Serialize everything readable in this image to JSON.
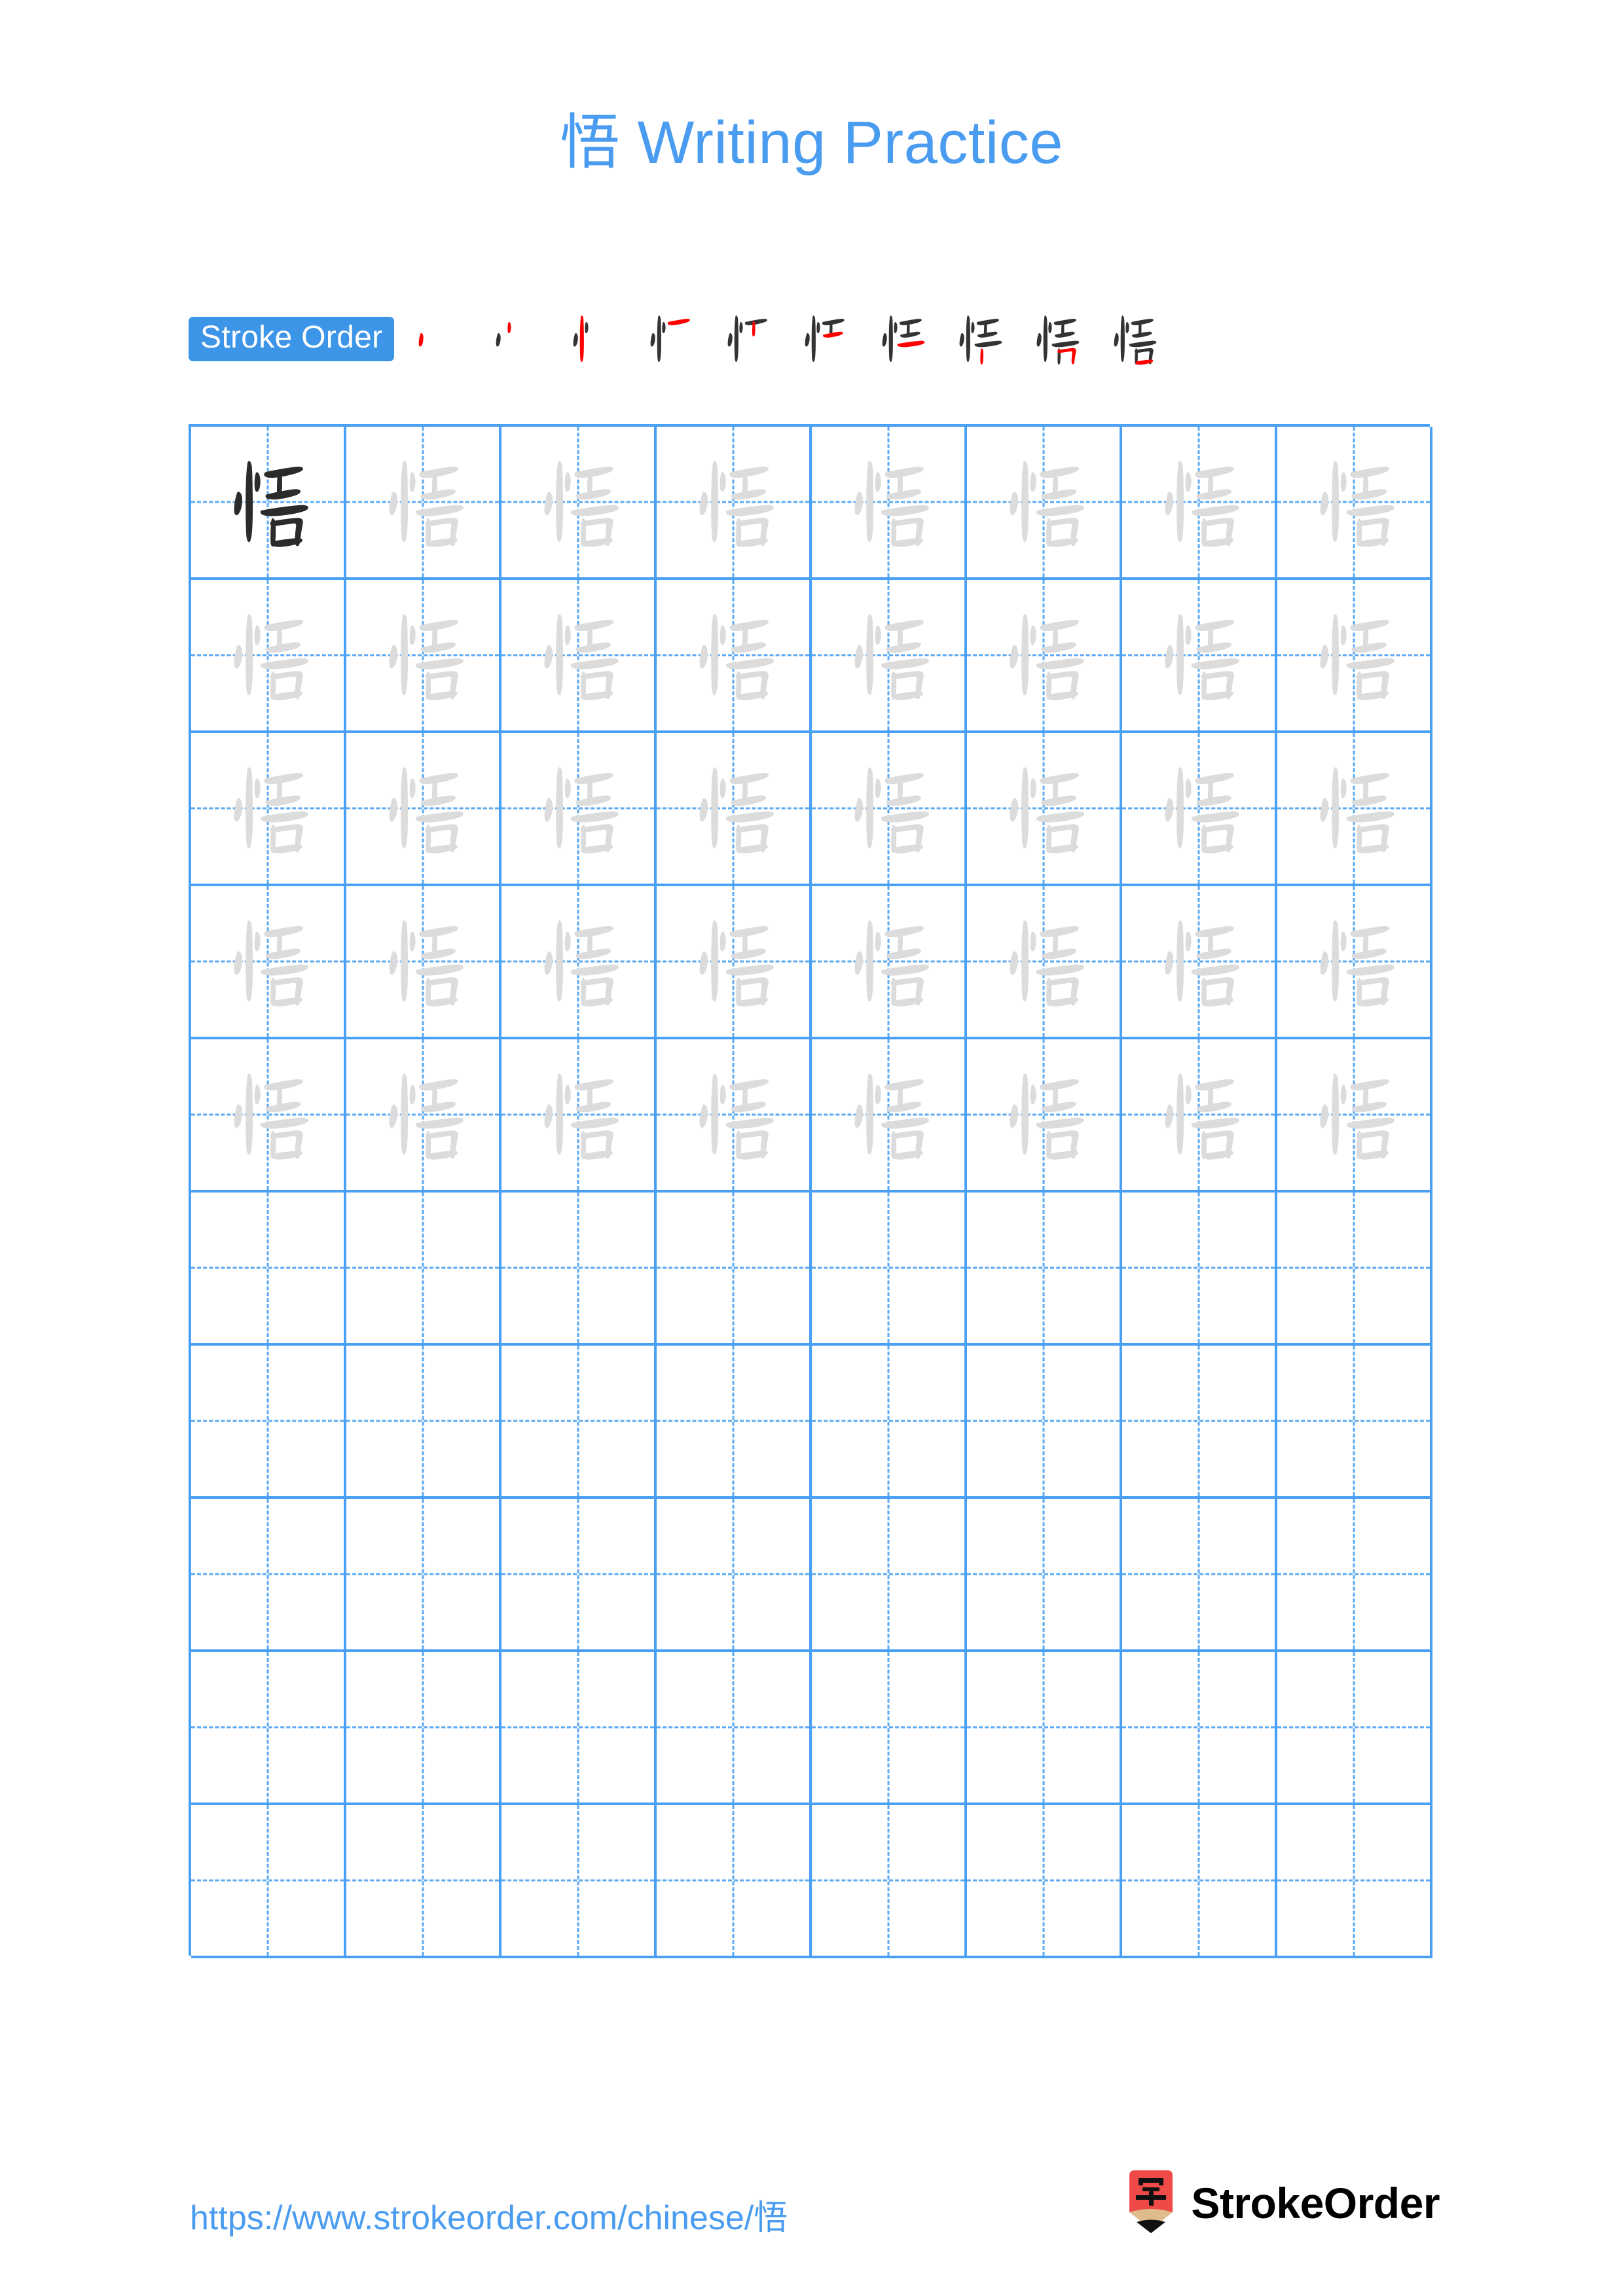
{
  "page": {
    "character": "悟",
    "title": "悟 Writing Practice",
    "title_color": "#4a9cf0",
    "background_color": "#ffffff"
  },
  "stroke_order": {
    "badge_label": "Stroke Order",
    "badge_bg": "#3d95e8",
    "badge_text_color": "#ffffff",
    "stroke_count": 10,
    "new_stroke_color": "#ff0000",
    "prior_stroke_color": "#333333",
    "steps": [
      {
        "index": 1,
        "strokes_shown": 1
      },
      {
        "index": 2,
        "strokes_shown": 2
      },
      {
        "index": 3,
        "strokes_shown": 3
      },
      {
        "index": 4,
        "strokes_shown": 4
      },
      {
        "index": 5,
        "strokes_shown": 5
      },
      {
        "index": 6,
        "strokes_shown": 6
      },
      {
        "index": 7,
        "strokes_shown": 7
      },
      {
        "index": 8,
        "strokes_shown": 8
      },
      {
        "index": 9,
        "strokes_shown": 9
      },
      {
        "index": 10,
        "strokes_shown": 10
      }
    ]
  },
  "grid": {
    "columns": 8,
    "rows": 10,
    "line_color": "#49a0f5",
    "guide_color": "#5aa9f2",
    "model_char_color": "#2b2b2b",
    "trace_char_color": "#dcdcdc",
    "rows_data": [
      {
        "row": 1,
        "cells": [
          "model",
          "trace",
          "trace",
          "trace",
          "trace",
          "trace",
          "trace",
          "trace"
        ]
      },
      {
        "row": 2,
        "cells": [
          "trace",
          "trace",
          "trace",
          "trace",
          "trace",
          "trace",
          "trace",
          "trace"
        ]
      },
      {
        "row": 3,
        "cells": [
          "trace",
          "trace",
          "trace",
          "trace",
          "trace",
          "trace",
          "trace",
          "trace"
        ]
      },
      {
        "row": 4,
        "cells": [
          "trace",
          "trace",
          "trace",
          "trace",
          "trace",
          "trace",
          "trace",
          "trace"
        ]
      },
      {
        "row": 5,
        "cells": [
          "trace",
          "trace",
          "trace",
          "trace",
          "trace",
          "trace",
          "trace",
          "trace"
        ]
      },
      {
        "row": 6,
        "cells": [
          "empty",
          "empty",
          "empty",
          "empty",
          "empty",
          "empty",
          "empty",
          "empty"
        ]
      },
      {
        "row": 7,
        "cells": [
          "empty",
          "empty",
          "empty",
          "empty",
          "empty",
          "empty",
          "empty",
          "empty"
        ]
      },
      {
        "row": 8,
        "cells": [
          "empty",
          "empty",
          "empty",
          "empty",
          "empty",
          "empty",
          "empty",
          "empty"
        ]
      },
      {
        "row": 9,
        "cells": [
          "empty",
          "empty",
          "empty",
          "empty",
          "empty",
          "empty",
          "empty",
          "empty"
        ]
      },
      {
        "row": 10,
        "cells": [
          "empty",
          "empty",
          "empty",
          "empty",
          "empty",
          "empty",
          "empty",
          "empty"
        ]
      }
    ]
  },
  "footer": {
    "url": "https://www.strokeorder.com/chinese/悟",
    "url_color": "#4a9cf0",
    "brand_name": "StrokeOrder",
    "logo_char": "字",
    "logo_body_color": "#ef4a47",
    "logo_tip_color": "#e0bb8e",
    "logo_point_color": "#111111"
  }
}
